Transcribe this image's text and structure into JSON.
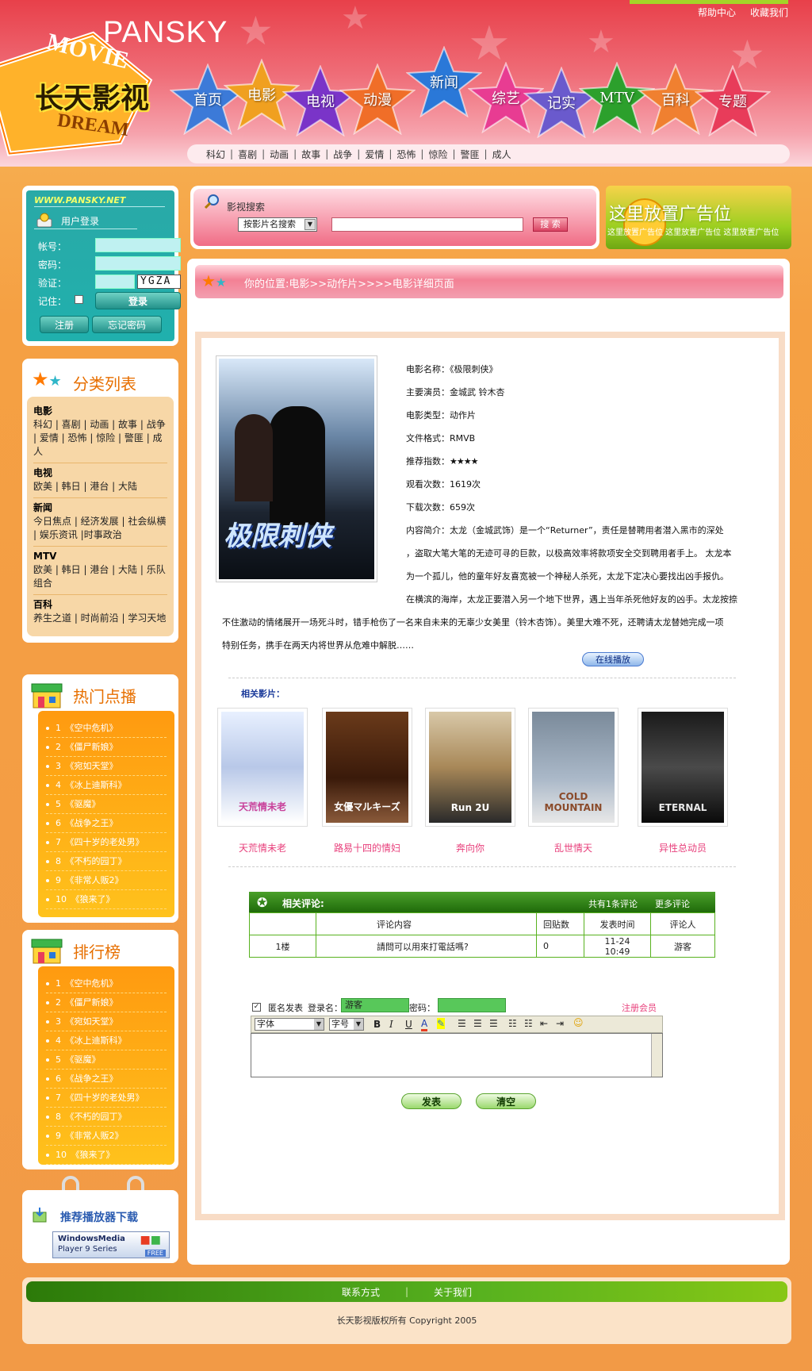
{
  "header": {
    "brand": "PANSKY",
    "logo_cn": "长天影视",
    "logo_movie": "MOVIE",
    "logo_dream": "DREAM",
    "top_links": [
      "帮助中心",
      "收藏我们"
    ],
    "nav": [
      "首页",
      "电影",
      "电视",
      "动漫",
      "新闻",
      "综艺",
      "记实",
      "MTV",
      "百科",
      "专题"
    ],
    "nav_colors": [
      "#3c7ad8",
      "#f0a020",
      "#7a34c8",
      "#f06e28",
      "#2a78d8",
      "#e83c92",
      "#6a5acd",
      "#2ca02c",
      "#f08030",
      "#e83c5a"
    ],
    "subnav": [
      "科幻",
      "喜剧",
      "动画",
      "故事",
      "战争",
      "爱情",
      "恐怖",
      "惊险",
      "警匪",
      "成人"
    ]
  },
  "login": {
    "site": "WWW.PANSKY.NET",
    "title": "用户登录",
    "account_label": "帐号：",
    "password_label": "密码：",
    "verify_label": "验证：",
    "captcha": "YGZA",
    "remember_label": "记住：",
    "login_btn": "登录",
    "register_btn": "注册",
    "forgot_btn": "忘记密码"
  },
  "categories": {
    "title": "分类列表",
    "groups": [
      {
        "name": "电影",
        "items": "科幻 | 喜剧 | 动画 | 故事 | 战争 | 爱情 | 恐怖 | 惊险 | 警匪 | 成人"
      },
      {
        "name": "电视",
        "items": "欧美 | 韩日 | 港台 | 大陆"
      },
      {
        "name": "新闻",
        "items": "今日焦点 | 经济发展 | 社会纵横 | 娱乐资讯 |时事政治"
      },
      {
        "name": "MTV",
        "items": "欧美 | 韩日 | 港台 | 大陆 | 乐队组合"
      },
      {
        "name": "百科",
        "items": "养生之道 | 时尚前沿 | 学习天地"
      }
    ]
  },
  "hot": {
    "title": "热门点播",
    "items": [
      "1　《空中危机》",
      "2　《僵尸新娘》",
      "3　《宛如天堂》",
      "4　《冰上迪斯科》",
      "5　《驱魔》",
      "6　《战争之王》",
      "7　《四十岁的老处男》",
      "8　《不朽的园丁》",
      "9　《非常人贩2》",
      "10　《狼来了》"
    ]
  },
  "rank": {
    "title": "排行榜",
    "items": [
      "1　《空中危机》",
      "2　《僵尸新娘》",
      "3　《宛如天堂》",
      "4　《冰上迪斯科》",
      "5　《驱魔》",
      "6　《战争之王》",
      "7　《四十岁的老处男》",
      "8　《不朽的园丁》",
      "9　《非常人贩2》",
      "10　《狼来了》"
    ]
  },
  "download": {
    "title": "推荐播放器下载",
    "player_line1": "WindowsMedia",
    "player_line2": "Player 9 Series",
    "player_free": "FREE"
  },
  "search": {
    "title": "影视搜索",
    "select_value": "按影片名搜索",
    "button": "搜 索"
  },
  "ad": {
    "headline": "这里放置广告位",
    "subline": "这里放置广告位 这里放置广告位 这里放置广告位"
  },
  "breadcrumb": "你的位置:电影>>动作片>>>>电影详细页面",
  "movie": {
    "poster_title": "极限刺侠",
    "name": "电影名称：《极限刺侠》",
    "actors": "主要演员：金城武 铃木杏",
    "type": "电影类型：动作片",
    "format": "文件格式：RMVB",
    "rating_label": "推荐指数：",
    "rating": 4,
    "views": "观看次数：1619次",
    "downloads": "下载次数：659次",
    "desc1": "内容简介：太龙（金城武饰）是一个“Returner”，责任是替聘用者潜入黑市的深处",
    "desc2": "，盗取大笔大笔的无迹可寻的巨款，以极高效率将款项安全交到聘用者手上。 太龙本",
    "desc3": "为一个孤儿，他的童年好友喜宽被一个神秘人杀死，太龙下定决心要找出凶手报仇。",
    "desc4": "在横滨的海岸，太龙正要潜入另一个地下世界，遇上当年杀死他好友的凶手。太龙按捺",
    "desc5": "不住激动的情绪展开一场死斗时，错手枪伤了一名来自未来的无辜少女美里（铃木杏饰）。美里大难不死，还聘请太龙替她完成一项",
    "desc6": "特别任务，携手在两天内将世界从危难中解脱……",
    "play_btn": "在线播放"
  },
  "related": {
    "title": "相关影片：",
    "films": [
      "天荒情未老",
      "路易十四的情妇",
      "奔向你",
      "乱世情天",
      "异性总动员"
    ],
    "poster_texts": [
      "天荒情未老",
      "女優マルキーズ",
      "Run 2U",
      "COLD MOUNTAIN",
      "ETERNAL"
    ]
  },
  "comments": {
    "title": "相关评论:",
    "count": "共有1条评论",
    "more": "更多评论",
    "headers": [
      "",
      "评论内容",
      "回贴数",
      "发表时间",
      "评论人"
    ],
    "rows": [
      [
        "1楼",
        "請問可以用來打電話嗎?",
        "0",
        "11-24 10:49",
        "游客"
      ]
    ]
  },
  "post": {
    "anon_label": "匿名发表",
    "login_label": "登录名：",
    "login_value": "游客",
    "pwd_label": "密码：",
    "register": "注册会员",
    "font_select": "字体",
    "size_select": "字号",
    "submit": "发表",
    "clear": "清空"
  },
  "footer": {
    "links": [
      "联系方式",
      "关于我们"
    ],
    "copyright": "长天影视版权所有 Copyright 2005"
  }
}
